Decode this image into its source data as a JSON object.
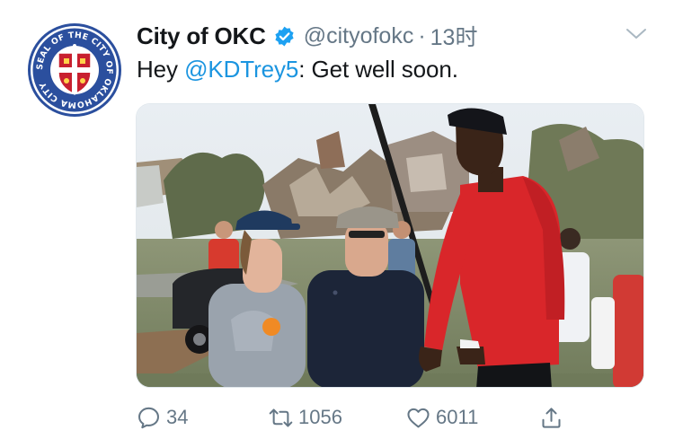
{
  "tweet": {
    "avatar_icon": "city-seal-icon",
    "seal_text": "SEAL OF THE CITY OF OKLAHOMA CITY",
    "display_name": "City of OKC",
    "verified_icon": "verified-badge-icon",
    "handle": "@cityofokc",
    "separator": "·",
    "time": "13时",
    "menu_icon": "chevron-down-icon",
    "text_prefix": "Hey ",
    "mention": "@KDTrey5",
    "text_suffix": ": Get well soon.",
    "photo_icon": "photo-image"
  },
  "actions": {
    "reply": {
      "icon": "reply-icon",
      "count": "34"
    },
    "retweet": {
      "icon": "retweet-icon",
      "count": "1056"
    },
    "like": {
      "icon": "heart-icon",
      "count": "6011"
    },
    "share": {
      "icon": "share-icon"
    }
  },
  "colors": {
    "link": "#1b95e0",
    "secondary_text": "#657786",
    "primary_text": "#14171a",
    "verified": "#1da1f2",
    "seal_blue": "#2b4f9e",
    "seal_red": "#c8202f"
  }
}
